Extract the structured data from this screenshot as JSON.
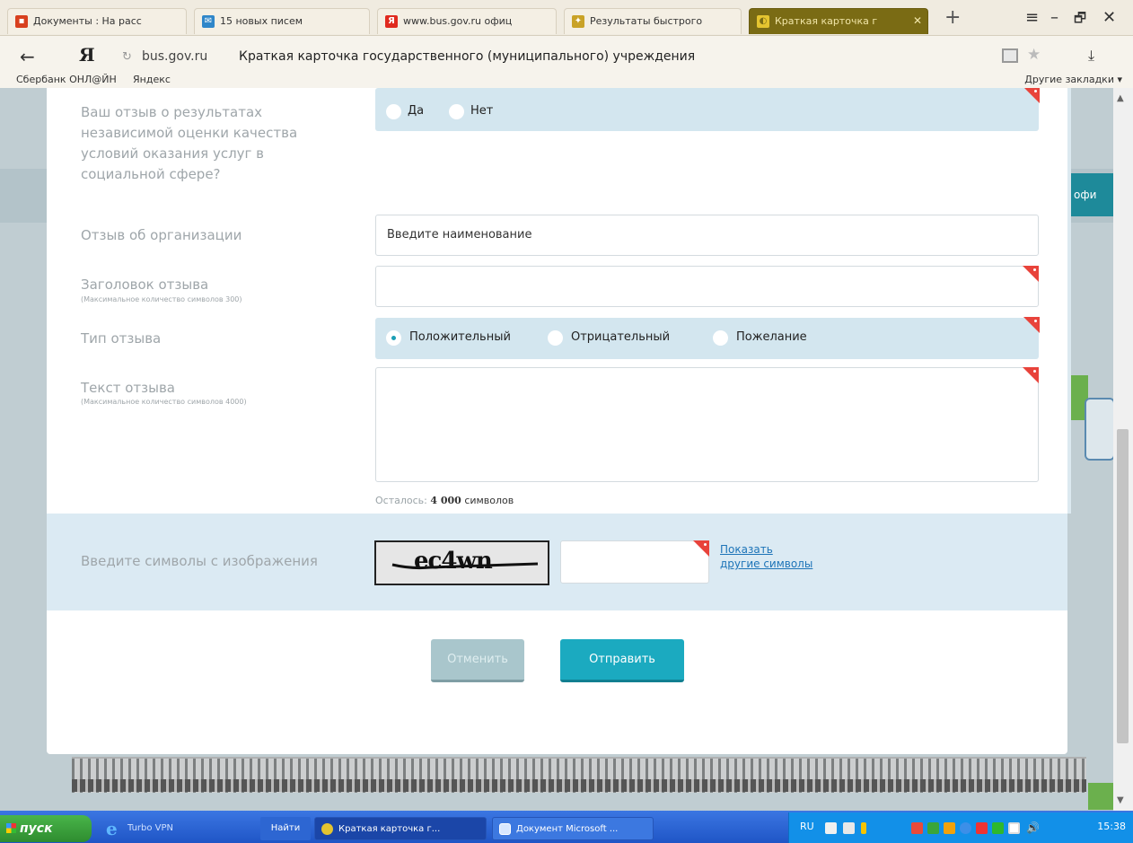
{
  "browser": {
    "tabs": [
      {
        "label": "Документы : На расс",
        "favicon_color": "#d8401f",
        "active": false
      },
      {
        "label": "15 новых писем",
        "favicon_color": "#2f86c9",
        "active": false
      },
      {
        "label": "www.bus.gov.ru офиц",
        "favicon_color": "#e02a1f",
        "active": false
      },
      {
        "label": "Результаты быстрого",
        "favicon_color": "#c9a227",
        "active": false
      },
      {
        "label": "Краткая карточка г",
        "favicon_color": "#e5c430",
        "active": true
      }
    ],
    "new_tab": "+",
    "window_controls": {
      "menu": "≡",
      "minimize": "–",
      "restore": "🗗",
      "close": "✕"
    },
    "back": "←",
    "logo": "Я",
    "url_host": "bus.gov.ru",
    "page_title": "Краткая карточка государственного (муниципального) учреждения",
    "bookmarks": {
      "sber": "Сбербанк ОНЛ@ЙН",
      "yandex": "Яндекс",
      "other": "Другие закладки ▾"
    }
  },
  "background": {
    "side_button": "офи"
  },
  "form": {
    "question_label": "Ваш отзыв о результатах независимой оценки качества условий оказания услуг в социальной сфере?",
    "question_options": [
      "Да",
      "Нет"
    ],
    "organization_label": "Отзыв об организации",
    "organization_placeholder": "Введите наименование",
    "title_label": "Заголовок отзыва",
    "title_hint": "(Максимальное количество символов 300)",
    "title_value": "",
    "type_label": "Тип отзыва",
    "type_options": [
      "Положительный",
      "Отрицательный",
      "Пожелание"
    ],
    "type_selected": "Положительный",
    "text_label": "Текст отзыва",
    "text_hint": "(Максимальное количество символов 4000)",
    "text_value": "",
    "remaining_prefix": "Осталось:",
    "remaining_count": "4 000",
    "remaining_suffix": "символов",
    "captcha_label": "Введите символы с изображения",
    "captcha_text": "ec4wn",
    "captcha_value": "",
    "captcha_refresh_line1": "Показать",
    "captcha_refresh_line2": "другие символы",
    "cancel": "Отменить",
    "submit": "Отправить"
  },
  "taskbar": {
    "start": "пуск",
    "turbovpn": "Turbo VPN",
    "search": "Найти",
    "windows": [
      "Краткая карточка г...",
      "Документ Microsoft ..."
    ],
    "lang": "RU",
    "time": "15:38"
  }
}
